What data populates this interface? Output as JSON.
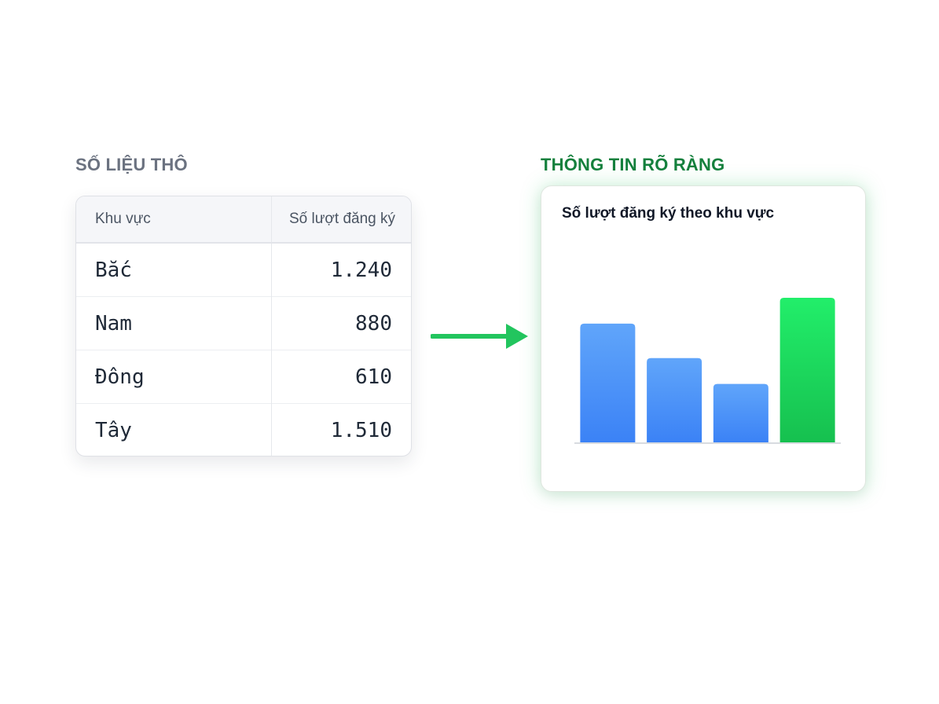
{
  "raw_section": {
    "label": "SỐ LIỆU THÔ",
    "color": "#6b7280"
  },
  "clear_section": {
    "label": "THÔNG TIN RÕ RÀNG",
    "color": "#15803d"
  },
  "table": {
    "headers": [
      "Khu vực",
      "Số lượt đăng ký"
    ],
    "rows": [
      {
        "region": "Bắc",
        "value": "1.240"
      },
      {
        "region": "Nam",
        "value": "880"
      },
      {
        "region": "Đông",
        "value": "610"
      },
      {
        "region": "Tây",
        "value": "1.510"
      }
    ]
  },
  "arrow": {
    "icon": "arrow-right-icon",
    "color": "#22c55e"
  },
  "chart_data": {
    "type": "bar",
    "title": "Số lượt đăng ký theo khu vực",
    "categories": [
      "Bắc",
      "Nam",
      "Đông",
      "Tây"
    ],
    "values": [
      1240,
      880,
      610,
      1510
    ],
    "show_category_labels": false,
    "ylim": [
      0,
      1510
    ],
    "grid": false,
    "highlight_index": 3,
    "colors": {
      "default_top": "#60a5fa",
      "default_bottom": "#3b82f6",
      "highlight_top": "#22ee6a",
      "highlight_bottom": "#16c04f",
      "baseline": "#d8dbe0"
    }
  }
}
